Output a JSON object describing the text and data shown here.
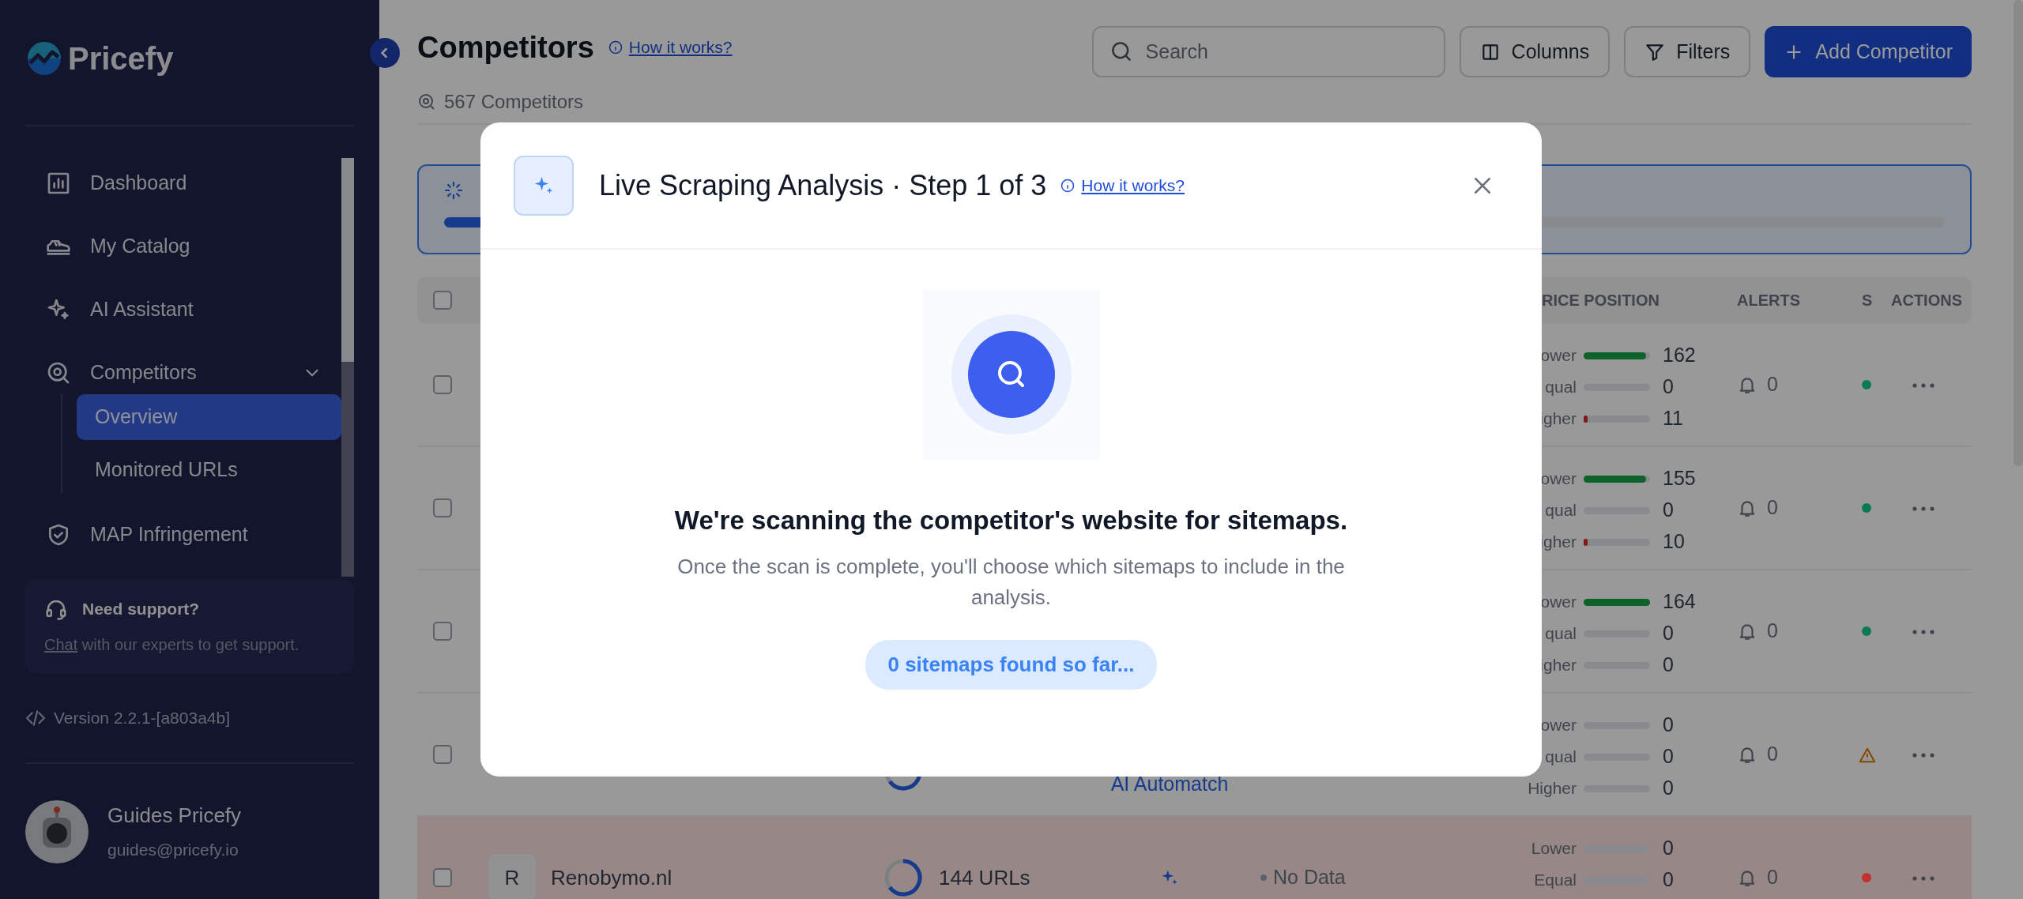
{
  "sidebar": {
    "brand": "Pricefy",
    "nav": [
      {
        "label": "Dashboard",
        "selected": false
      },
      {
        "label": "My Catalog",
        "selected": false
      },
      {
        "label": "AI Assistant",
        "selected": false
      },
      {
        "label": "Competitors",
        "selected": false,
        "expanded": true,
        "children": [
          {
            "label": "Overview",
            "selected": true
          },
          {
            "label": "Monitored URLs",
            "selected": false
          }
        ]
      },
      {
        "label": "MAP Infringement",
        "selected": false
      }
    ],
    "support": {
      "title": "Need support?",
      "link": "Chat",
      "text": " with our experts to get support."
    },
    "version": "Version 2.2.1-[a803a4b]",
    "user": {
      "name": "Guides Pricefy",
      "email": "guides@pricefy.io"
    }
  },
  "header": {
    "title": "Competitors",
    "help_link": "How it works?",
    "count": "567 Competitors",
    "search": {
      "placeholder": "Search"
    },
    "buttons": [
      {
        "label": "Columns",
        "kind": "columns"
      },
      {
        "label": "Filters",
        "kind": "filters"
      },
      {
        "label": "Add Competitor",
        "kind": "add"
      }
    ]
  },
  "progress_banner": {
    "level": 0.03
  },
  "table": {
    "header_checkbox": {
      "checked": false
    },
    "columns": [
      {
        "label": "RICE POSITION",
        "kind": "price"
      },
      {
        "label": "ALERTS",
        "kind": "alerts"
      },
      {
        "label": "S",
        "kind": "status"
      },
      {
        "label": "ACTIONS",
        "kind": "actions"
      }
    ],
    "rows": [
      {
        "checked": false,
        "flagged": false,
        "price": [
          {
            "label": "ower",
            "value": "162",
            "level": 0.94,
            "kind": "lower"
          },
          {
            "label": "qual",
            "value": "0",
            "level": 0,
            "kind": "equal"
          },
          {
            "label": "igher",
            "value": "11",
            "level": 0.06,
            "kind": "higher"
          }
        ],
        "alerts": "0",
        "status": {
          "kind": "dot",
          "color": "#0a7a55"
        }
      },
      {
        "checked": false,
        "flagged": false,
        "price": [
          {
            "label": "ower",
            "value": "155",
            "level": 0.94,
            "kind": "lower"
          },
          {
            "label": "qual",
            "value": "0",
            "level": 0,
            "kind": "equal"
          },
          {
            "label": "igher",
            "value": "10",
            "level": 0.06,
            "kind": "higher"
          }
        ],
        "alerts": "0",
        "status": {
          "kind": "dot",
          "color": "#0a7a55"
        }
      },
      {
        "checked": false,
        "flagged": false,
        "price": [
          {
            "label": "ower",
            "value": "164",
            "level": 1,
            "kind": "lower"
          },
          {
            "label": "qual",
            "value": "0",
            "level": 0,
            "kind": "equal"
          },
          {
            "label": "igher",
            "value": "0",
            "level": 0,
            "kind": "higher"
          }
        ],
        "alerts": "0",
        "status": {
          "kind": "dot",
          "color": "#0a7a55"
        }
      },
      {
        "checked": false,
        "flagged": false,
        "urls": {
          "loading": true
        },
        "match": {
          "label": "AI Automatch"
        },
        "price": [
          {
            "label": "ower",
            "value": "0",
            "level": 0,
            "kind": "lower"
          },
          {
            "label": "qual",
            "value": "0",
            "level": 0,
            "kind": "equal"
          },
          {
            "label": "Higher",
            "value": "0",
            "level": 0,
            "kind": "higher"
          }
        ],
        "alerts": "0",
        "status": {
          "kind": "warning"
        }
      },
      {
        "checked": false,
        "flagged": true,
        "avatar": "R",
        "name": "Renobymo.nl",
        "urls": {
          "loading": true,
          "label": "144 URLs"
        },
        "match": {
          "icon": true
        },
        "data_status": "No Data",
        "price": [
          {
            "label": "Lower",
            "value": "0",
            "level": 0,
            "kind": "lower"
          },
          {
            "label": "Equal",
            "value": "0",
            "level": 0,
            "kind": "equal"
          }
        ],
        "alerts": "0",
        "status": {
          "kind": "dot",
          "color": "#c62f2f"
        }
      }
    ]
  },
  "modal": {
    "title": "Live Scraping Analysis · Step 1 of 3",
    "help_link": "How it works?",
    "heading": "We're scanning the competitor's website for sitemaps.",
    "text": "Once the scan is complete, you'll choose which sitemaps to include in the analysis.",
    "pill": "0 sitemaps found so far..."
  }
}
